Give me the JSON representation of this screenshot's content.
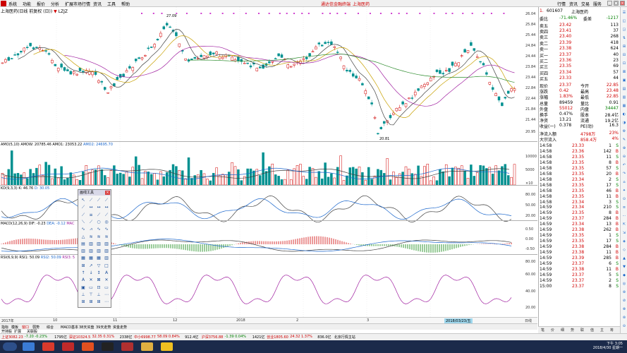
{
  "menubar": {
    "items": [
      "系统",
      "功能",
      "报价",
      "分析",
      "扩展市场行情",
      "资讯",
      "工具",
      "帮助"
    ],
    "ad_text": "通达信金融终端",
    "ad_stock": "上海医药",
    "right_items": [
      "行情",
      "资讯",
      "交易",
      "服务"
    ]
  },
  "chart_header": {
    "title": "上海医药(日线 前复权 (日))",
    "flag": "▼",
    "tag": "LZJZ"
  },
  "price_labels": {
    "high": "27.09",
    "low": "20.81"
  },
  "right_axis": {
    "main": [
      "26.04",
      "25.84",
      "25.44",
      "24.84",
      "24.44",
      "23.84",
      "23.44",
      "22.84",
      "22.44",
      "21.84",
      "21.44",
      "20.95"
    ],
    "amo": [
      "10000",
      "5000"
    ],
    "amo_unit": "×10",
    "kdj": [
      "80.00",
      "50.00",
      "20.00"
    ],
    "macd": [
      "0.50",
      "0.00",
      "-0.50"
    ],
    "rsi": [
      "80.00",
      "60.00",
      "40.00",
      "20.00"
    ]
  },
  "indicators": {
    "amo": {
      "name": "AMO(5,10)",
      "amow_label": "AMOW: 20785.46",
      "amo1_label": "AMO1: 23053.22",
      "amo2_label": "AMO2: 24695.70"
    },
    "kdj": {
      "name": "KD(9,3,3)",
      "k_label": "K: 46.76",
      "d_label": "D: 30.05"
    },
    "macd": {
      "name": "MACD(12,26,9)",
      "dif_label": "DIF: -0.23",
      "dea_label": "DEA: -0.12",
      "macd_label": "MAC"
    },
    "rsi": {
      "name": "RSI(6,9,9)",
      "rsi1_label": "RSI1: 50.09",
      "rsi2_label": "RSI2: 50.09",
      "rsi3_label": "RSI3: 5"
    }
  },
  "date_strip": {
    "year": "2017年",
    "months": [
      "10",
      "11",
      "12",
      "2018",
      "2",
      "3"
    ],
    "cursor_date": "2018/03/23/五",
    "period": "日线"
  },
  "bottom_tabs": [
    "指标",
    "模板",
    "窗口",
    "弱势",
    "综合",
    "MACD基本",
    "38天买盘",
    "39天走势",
    "资金走势"
  ],
  "bottom_tabs2": [
    "开持股",
    "扩展",
    "关联股"
  ],
  "active_tab": "窗口",
  "draw_tools": {
    "title": "画线工具"
  },
  "side_panel": {
    "stock_code": "601607",
    "stock_name": "上海医药",
    "webi_label": "委比",
    "webi_value": "-71.46%",
    "weicha_label": "委差",
    "weicha_value": "-1217",
    "sells": [
      {
        "label": "卖五",
        "price": "23.42",
        "vol": "113"
      },
      {
        "label": "卖四",
        "price": "23.41",
        "vol": "37"
      },
      {
        "label": "卖三",
        "price": "23.40",
        "vol": "268"
      },
      {
        "label": "卖二",
        "price": "23.39",
        "vol": "418"
      },
      {
        "label": "卖一",
        "price": "23.38",
        "vol": "624"
      }
    ],
    "buys": [
      {
        "label": "买一",
        "price": "23.37",
        "vol": "40"
      },
      {
        "label": "买二",
        "price": "23.36",
        "vol": "23"
      },
      {
        "label": "买三",
        "price": "23.35",
        "vol": "69"
      },
      {
        "label": "买四",
        "price": "23.34",
        "vol": "57"
      },
      {
        "label": "买五",
        "price": "23.33",
        "vol": "44"
      }
    ],
    "stats": [
      {
        "l1": "现价",
        "v1": "23.37",
        "l2": "今开",
        "v2": "22.85"
      },
      {
        "l1": "涨跌",
        "v1": "0.42",
        "l2": "最高",
        "v2": "23.48"
      },
      {
        "l1": "涨幅",
        "v1": "1.83%",
        "l2": "最低",
        "v2": "22.85"
      },
      {
        "l1": "总量",
        "v1": "89459",
        "l2": "量比",
        "v2": "0.91"
      },
      {
        "l1": "外盘",
        "v1": "55012",
        "l2": "内盘",
        "v2": "34447"
      },
      {
        "l1": "换手",
        "v1": "0.47%",
        "l2": "股本",
        "v2": "28.4亿"
      },
      {
        "l1": "净资",
        "v1": "13.21",
        "l2": "流通",
        "v2": "19.2亿"
      },
      {
        "l1": "收益(一)",
        "v1": "0.378",
        "l2": "PE(动)",
        "v2": "16.3"
      }
    ],
    "flow": [
      {
        "label": "净流入额",
        "value": "4798万",
        "pct": "23%"
      },
      {
        "label": "大宗流入",
        "value": "858.4万",
        "pct": "4%"
      }
    ],
    "ticks": [
      {
        "t": "14:58",
        "p": "23.33",
        "v": "1",
        "d": "S"
      },
      {
        "t": "14:58",
        "p": "23.36",
        "v": "142",
        "d": "B"
      },
      {
        "t": "14:58",
        "p": "23.35",
        "v": "11",
        "d": "S"
      },
      {
        "t": "14:58",
        "p": "23.35",
        "v": "8",
        "d": "B"
      },
      {
        "t": "14:58",
        "p": "23.35",
        "v": "57",
        "d": "S"
      },
      {
        "t": "14:58",
        "p": "23.35",
        "v": "20",
        "d": "B"
      },
      {
        "t": "14:58",
        "p": "23.34",
        "v": "2",
        "d": "S"
      },
      {
        "t": "14:58",
        "p": "23.35",
        "v": "17",
        "d": "S"
      },
      {
        "t": "14:58",
        "p": "23.35",
        "v": "46",
        "d": "B"
      },
      {
        "t": "14:58",
        "p": "23.35",
        "v": "11",
        "d": "B"
      },
      {
        "t": "14:58",
        "p": "23.34",
        "v": "3",
        "d": "S"
      },
      {
        "t": "14:59",
        "p": "23.34",
        "v": "210",
        "d": "S"
      },
      {
        "t": "14:59",
        "p": "23.35",
        "v": "8",
        "d": "B"
      },
      {
        "t": "14:59",
        "p": "23.37",
        "v": "284",
        "d": "B"
      },
      {
        "t": "14:59",
        "p": "23.34",
        "v": "13",
        "d": "B"
      },
      {
        "t": "14:59",
        "p": "23.38",
        "v": "262",
        "d": "B"
      },
      {
        "t": "14:59",
        "p": "23.35",
        "v": "1",
        "d": "S"
      },
      {
        "t": "14:59",
        "p": "23.35",
        "v": "17",
        "d": "S"
      },
      {
        "t": "14:59",
        "p": "23.38",
        "v": "284",
        "d": "B"
      },
      {
        "t": "14:59",
        "p": "23.38",
        "v": "11",
        "d": "B"
      },
      {
        "t": "14:59",
        "p": "23.39",
        "v": "285",
        "d": "B"
      },
      {
        "t": "14:59",
        "p": "23.37",
        "v": "6",
        "d": "S"
      },
      {
        "t": "14:59",
        "p": "23.38",
        "v": "11",
        "d": "B"
      },
      {
        "t": "14:59",
        "p": "23.37",
        "v": "5",
        "d": "S"
      },
      {
        "t": "14:59",
        "p": "23.37",
        "v": "2",
        "d": "S"
      },
      {
        "t": "15:00",
        "p": "23.37",
        "v": "8",
        "d": "S"
      }
    ],
    "bottom_tabs": [
      "笔",
      "价",
      "细",
      "势",
      "联",
      "值",
      "主",
      "筹"
    ]
  },
  "statusbar": {
    "items": [
      {
        "text": "上证3082.23",
        "c": "red"
      },
      {
        "text": "-7.20 -0.23%",
        "c": "green"
      },
      {
        "text": "1795亿",
        "c": "black"
      },
      {
        "text": "深证10324.5",
        "c": "red"
      },
      {
        "text": "32.35 0.31%",
        "c": "red"
      },
      {
        "text": "2338亿",
        "c": "black"
      },
      {
        "text": "中小6998.77",
        "c": "red"
      },
      {
        "text": "58.09 0.84%",
        "c": "red"
      },
      {
        "text": "912.4亿",
        "c": "black"
      },
      {
        "text": "沪深3756.88",
        "c": "red"
      },
      {
        "text": "-1.39 0.04%",
        "c": "green"
      },
      {
        "text": "1421亿",
        "c": "black"
      },
      {
        "text": "创业1805.60",
        "c": "red"
      },
      {
        "text": "24.32 1.37%",
        "c": "red"
      },
      {
        "text": "836.0亿",
        "c": "black"
      },
      {
        "text": "北京行情主站",
        "c": "black"
      }
    ]
  },
  "taskbar": {
    "time": "下午 3:05",
    "date": "2018/4/30 星期一"
  },
  "colors": {
    "up": "#d00000",
    "down": "#008000",
    "accent": "#1a66cc"
  }
}
